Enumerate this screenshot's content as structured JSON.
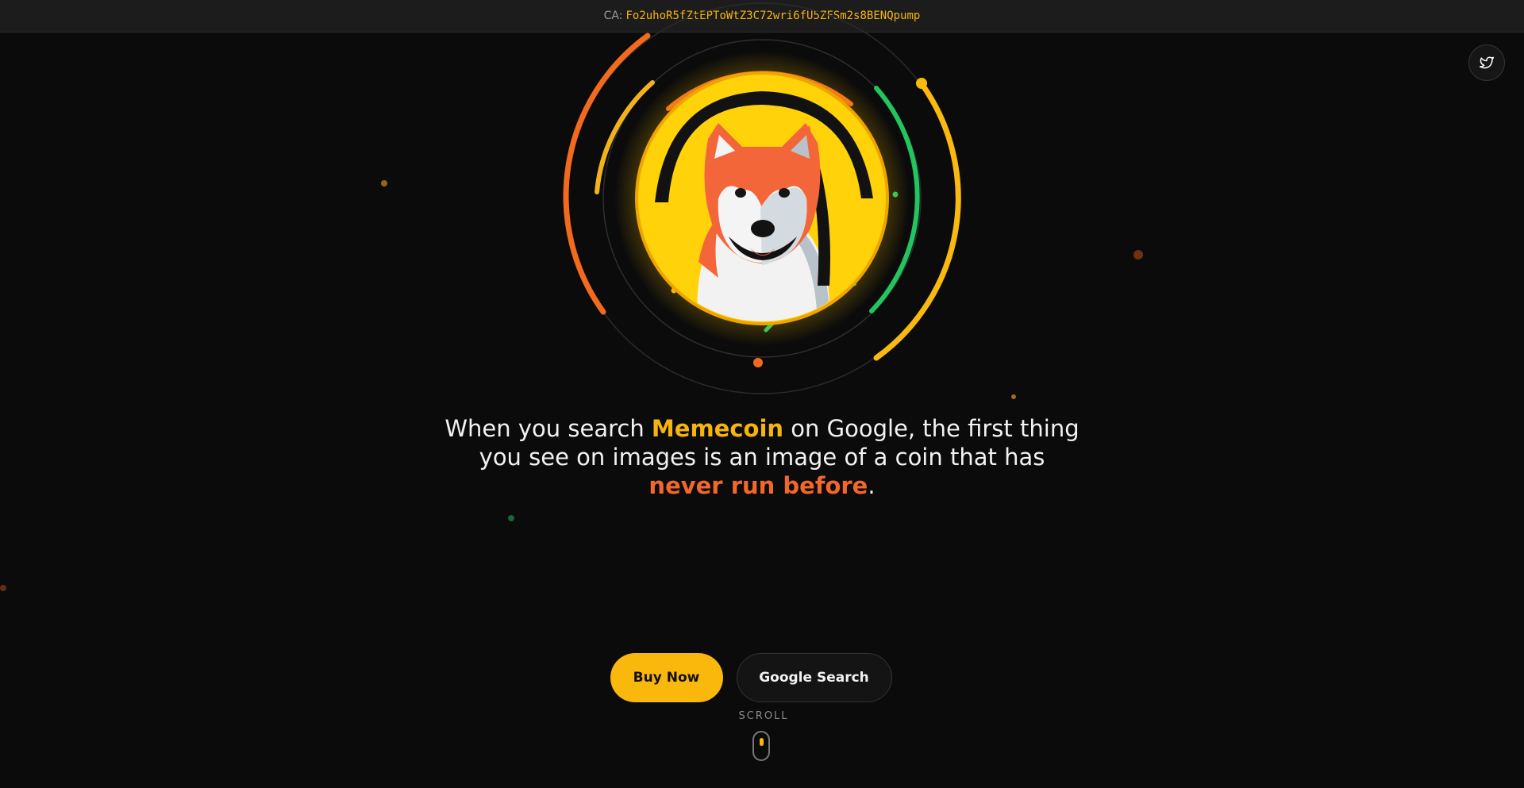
{
  "topbar": {
    "ca_label": "CA:",
    "ca_address": "Fo2uhoR5fZtEPToWtZ3C72wri6fU5ZFSm2s8BENQpump"
  },
  "social": {
    "twitter_icon": "twitter-bird-icon"
  },
  "headline": {
    "part1": "When you search ",
    "highlight1": "Memecoin",
    "part2": " on Google, the first thing you see on images is an image of a coin that has ",
    "highlight2": "never run before",
    "part3": "."
  },
  "buttons": {
    "buy_label": "Buy Now",
    "google_label": "Google Search"
  },
  "scroll": {
    "label": "SCROLL"
  },
  "colors": {
    "background": "#0b0b0b",
    "accent_yellow": "#fbb80c",
    "accent_orange": "#f2672a",
    "accent_green": "#22c55e",
    "coin_yellow": "#ffd20a"
  },
  "hero": {
    "coin_icon": "shiba-inu-dog-coin-icon"
  }
}
